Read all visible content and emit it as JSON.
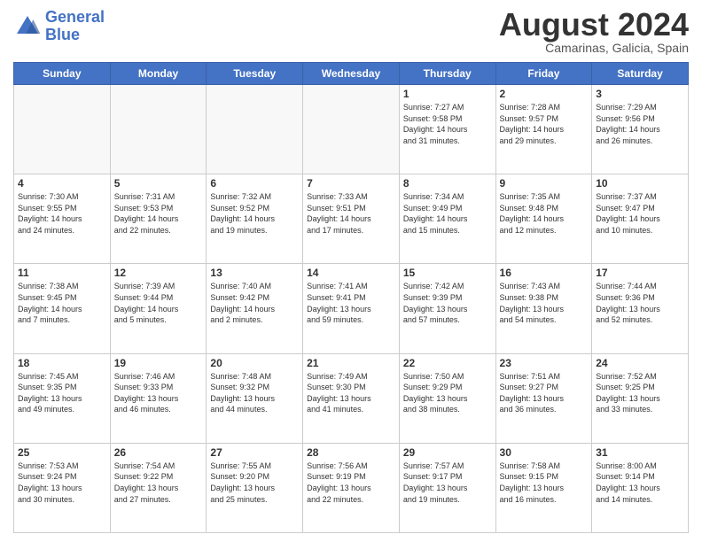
{
  "header": {
    "logo_line1": "General",
    "logo_line2": "Blue",
    "month_title": "August 2024",
    "subtitle": "Camarinas, Galicia, Spain"
  },
  "days_of_week": [
    "Sunday",
    "Monday",
    "Tuesday",
    "Wednesday",
    "Thursday",
    "Friday",
    "Saturday"
  ],
  "weeks": [
    [
      {
        "day": "",
        "info": ""
      },
      {
        "day": "",
        "info": ""
      },
      {
        "day": "",
        "info": ""
      },
      {
        "day": "",
        "info": ""
      },
      {
        "day": "1",
        "info": "Sunrise: 7:27 AM\nSunset: 9:58 PM\nDaylight: 14 hours\nand 31 minutes."
      },
      {
        "day": "2",
        "info": "Sunrise: 7:28 AM\nSunset: 9:57 PM\nDaylight: 14 hours\nand 29 minutes."
      },
      {
        "day": "3",
        "info": "Sunrise: 7:29 AM\nSunset: 9:56 PM\nDaylight: 14 hours\nand 26 minutes."
      }
    ],
    [
      {
        "day": "4",
        "info": "Sunrise: 7:30 AM\nSunset: 9:55 PM\nDaylight: 14 hours\nand 24 minutes."
      },
      {
        "day": "5",
        "info": "Sunrise: 7:31 AM\nSunset: 9:53 PM\nDaylight: 14 hours\nand 22 minutes."
      },
      {
        "day": "6",
        "info": "Sunrise: 7:32 AM\nSunset: 9:52 PM\nDaylight: 14 hours\nand 19 minutes."
      },
      {
        "day": "7",
        "info": "Sunrise: 7:33 AM\nSunset: 9:51 PM\nDaylight: 14 hours\nand 17 minutes."
      },
      {
        "day": "8",
        "info": "Sunrise: 7:34 AM\nSunset: 9:49 PM\nDaylight: 14 hours\nand 15 minutes."
      },
      {
        "day": "9",
        "info": "Sunrise: 7:35 AM\nSunset: 9:48 PM\nDaylight: 14 hours\nand 12 minutes."
      },
      {
        "day": "10",
        "info": "Sunrise: 7:37 AM\nSunset: 9:47 PM\nDaylight: 14 hours\nand 10 minutes."
      }
    ],
    [
      {
        "day": "11",
        "info": "Sunrise: 7:38 AM\nSunset: 9:45 PM\nDaylight: 14 hours\nand 7 minutes."
      },
      {
        "day": "12",
        "info": "Sunrise: 7:39 AM\nSunset: 9:44 PM\nDaylight: 14 hours\nand 5 minutes."
      },
      {
        "day": "13",
        "info": "Sunrise: 7:40 AM\nSunset: 9:42 PM\nDaylight: 14 hours\nand 2 minutes."
      },
      {
        "day": "14",
        "info": "Sunrise: 7:41 AM\nSunset: 9:41 PM\nDaylight: 13 hours\nand 59 minutes."
      },
      {
        "day": "15",
        "info": "Sunrise: 7:42 AM\nSunset: 9:39 PM\nDaylight: 13 hours\nand 57 minutes."
      },
      {
        "day": "16",
        "info": "Sunrise: 7:43 AM\nSunset: 9:38 PM\nDaylight: 13 hours\nand 54 minutes."
      },
      {
        "day": "17",
        "info": "Sunrise: 7:44 AM\nSunset: 9:36 PM\nDaylight: 13 hours\nand 52 minutes."
      }
    ],
    [
      {
        "day": "18",
        "info": "Sunrise: 7:45 AM\nSunset: 9:35 PM\nDaylight: 13 hours\nand 49 minutes."
      },
      {
        "day": "19",
        "info": "Sunrise: 7:46 AM\nSunset: 9:33 PM\nDaylight: 13 hours\nand 46 minutes."
      },
      {
        "day": "20",
        "info": "Sunrise: 7:48 AM\nSunset: 9:32 PM\nDaylight: 13 hours\nand 44 minutes."
      },
      {
        "day": "21",
        "info": "Sunrise: 7:49 AM\nSunset: 9:30 PM\nDaylight: 13 hours\nand 41 minutes."
      },
      {
        "day": "22",
        "info": "Sunrise: 7:50 AM\nSunset: 9:29 PM\nDaylight: 13 hours\nand 38 minutes."
      },
      {
        "day": "23",
        "info": "Sunrise: 7:51 AM\nSunset: 9:27 PM\nDaylight: 13 hours\nand 36 minutes."
      },
      {
        "day": "24",
        "info": "Sunrise: 7:52 AM\nSunset: 9:25 PM\nDaylight: 13 hours\nand 33 minutes."
      }
    ],
    [
      {
        "day": "25",
        "info": "Sunrise: 7:53 AM\nSunset: 9:24 PM\nDaylight: 13 hours\nand 30 minutes."
      },
      {
        "day": "26",
        "info": "Sunrise: 7:54 AM\nSunset: 9:22 PM\nDaylight: 13 hours\nand 27 minutes."
      },
      {
        "day": "27",
        "info": "Sunrise: 7:55 AM\nSunset: 9:20 PM\nDaylight: 13 hours\nand 25 minutes."
      },
      {
        "day": "28",
        "info": "Sunrise: 7:56 AM\nSunset: 9:19 PM\nDaylight: 13 hours\nand 22 minutes."
      },
      {
        "day": "29",
        "info": "Sunrise: 7:57 AM\nSunset: 9:17 PM\nDaylight: 13 hours\nand 19 minutes."
      },
      {
        "day": "30",
        "info": "Sunrise: 7:58 AM\nSunset: 9:15 PM\nDaylight: 13 hours\nand 16 minutes."
      },
      {
        "day": "31",
        "info": "Sunrise: 8:00 AM\nSunset: 9:14 PM\nDaylight: 13 hours\nand 14 minutes."
      }
    ]
  ]
}
